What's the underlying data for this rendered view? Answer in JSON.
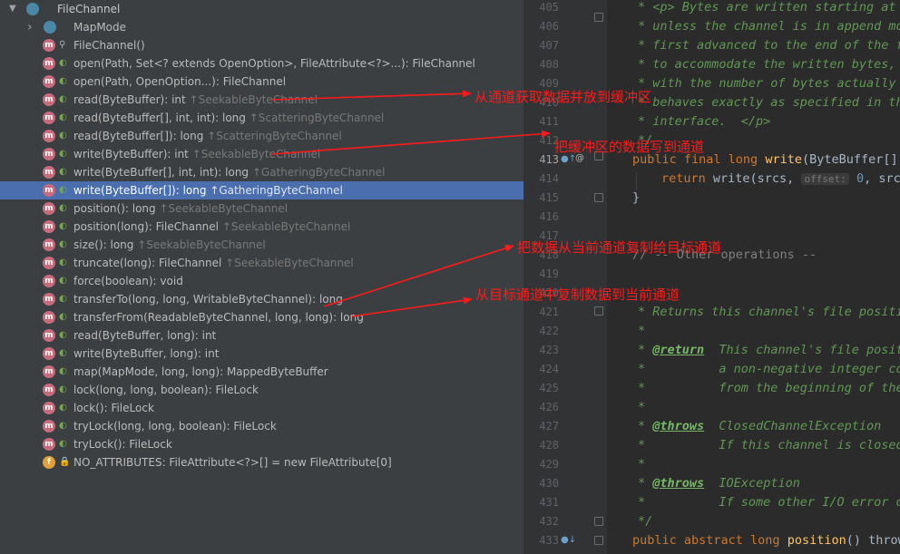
{
  "structure": {
    "root": "FileChannel",
    "items": [
      {
        "name": "MapMode",
        "type": "",
        "kind": "class"
      },
      {
        "name": "FileChannel()",
        "type": "",
        "kind": "ctor"
      },
      {
        "name": "open(Path, Set<? extends OpenOption>, FileAttribute<?>...): FileChannel",
        "type": "",
        "kind": "method"
      },
      {
        "name": "open(Path, OpenOption...): FileChannel",
        "type": "",
        "kind": "method"
      },
      {
        "name": "read(ByteBuffer): int",
        "type": "↑SeekableByteChannel",
        "kind": "method"
      },
      {
        "name": "read(ByteBuffer[], int, int): long",
        "type": "↑ScatteringByteChannel",
        "kind": "method"
      },
      {
        "name": "read(ByteBuffer[]): long",
        "type": "↑ScatteringByteChannel",
        "kind": "method"
      },
      {
        "name": "write(ByteBuffer): int",
        "type": "↑SeekableByteChannel",
        "kind": "method"
      },
      {
        "name": "write(ByteBuffer[], int, int): long",
        "type": "↑GatheringByteChannel",
        "kind": "method"
      },
      {
        "name": "write(ByteBuffer[]): long",
        "type": "↑GatheringByteChannel",
        "kind": "method",
        "selected": true
      },
      {
        "name": "position(): long",
        "type": "↑SeekableByteChannel",
        "kind": "method"
      },
      {
        "name": "position(long): FileChannel",
        "type": "↑SeekableByteChannel",
        "kind": "method"
      },
      {
        "name": "size(): long",
        "type": "↑SeekableByteChannel",
        "kind": "method"
      },
      {
        "name": "truncate(long): FileChannel",
        "type": "↑SeekableByteChannel",
        "kind": "method"
      },
      {
        "name": "force(boolean): void",
        "type": "",
        "kind": "method"
      },
      {
        "name": "transferTo(long, long, WritableByteChannel): long",
        "type": "",
        "kind": "method"
      },
      {
        "name": "transferFrom(ReadableByteChannel, long, long): long",
        "type": "",
        "kind": "method"
      },
      {
        "name": "read(ByteBuffer, long): int",
        "type": "",
        "kind": "method"
      },
      {
        "name": "write(ByteBuffer, long): int",
        "type": "",
        "kind": "method"
      },
      {
        "name": "map(MapMode, long, long): MappedByteBuffer",
        "type": "",
        "kind": "method"
      },
      {
        "name": "lock(long, long, boolean): FileLock",
        "type": "",
        "kind": "method"
      },
      {
        "name": "lock(): FileLock",
        "type": "",
        "kind": "method"
      },
      {
        "name": "tryLock(long, long, boolean): FileLock",
        "type": "",
        "kind": "method"
      },
      {
        "name": "tryLock(): FileLock",
        "type": "",
        "kind": "method"
      },
      {
        "name": "NO_ATTRIBUTES: FileAttribute<?>[] = new FileAttribute[0]",
        "type": "",
        "kind": "field"
      }
    ]
  },
  "editor": {
    "line_numbers": [
      "405",
      "406",
      "407",
      "408",
      "409",
      "410",
      "411",
      "412",
      "413",
      "414",
      "415",
      "416",
      "417",
      "418",
      "419",
      "420",
      "421",
      "422",
      "423",
      "424",
      "425",
      "426",
      "427",
      "428",
      "429",
      "430",
      "431",
      "432",
      "433"
    ],
    "lines": {
      "l405": "* <p> Bytes are written starting at",
      "l406": "* unless the channel is in append mo",
      "l407": "* first advanced to the end of the f",
      "l408": "* to accommodate the written bytes,",
      "l409": "* with the number of bytes actually",
      "l410": "* behaves exactly as specified in th",
      "l411": "* interface.  </p>",
      "l412": "*/",
      "l413_kw": "public final long ",
      "l413_fn": "write",
      "l413_rest": "(ByteBuffer[]",
      "l414_kw": "return ",
      "l414_call": "write(srcs, ",
      "l414_hint": "offset:",
      "l414_num": " 0",
      "l414_rest": ", srcs.",
      "l415": "}",
      "l418": "// -- Other operations --",
      "l421": "* Returns this channel's file positi",
      "l422": "*",
      "l423_tag": "@return",
      "l423_rest": "  This channel's file posit",
      "l424": "*          a non-negative integer co",
      "l425": "*          from the beginning of the",
      "l426": "*",
      "l427_tag": "@throws",
      "l427_rest": "  ClosedChannelException",
      "l428": "*          If this channel is closed",
      "l429": "*",
      "l430_tag": "@throws",
      "l430_rest": "  IOException",
      "l431": "*          If some other I/O error o",
      "l432": "*/",
      "l433_kw": "public abstract long ",
      "l433_fn": "position",
      "l433_rest": "() throw"
    }
  },
  "annotations": {
    "read_note": "从通道获取数据并放到缓冲区",
    "write_note": "把缓冲区的数据写到通道",
    "transfer_to_note": "把数据从当前通道复制给目标通道",
    "transfer_from_note": "从目标通道中复制数据到当前通道",
    "color": "#ff1a1a"
  },
  "colors": {
    "panel_bg": "#3c3f41",
    "editor_bg": "#2b2b2b",
    "selection": "#4b6eaf",
    "method_badge": "#c76b7d",
    "doc_comment": "#629755",
    "keyword": "#cc7832"
  }
}
